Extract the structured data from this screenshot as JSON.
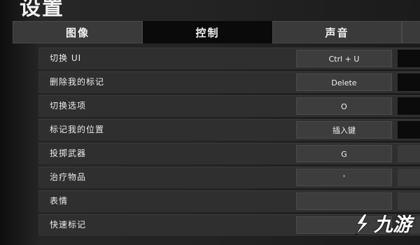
{
  "title": "设置",
  "tabs": [
    {
      "label": "图像",
      "active": false
    },
    {
      "label": "控制",
      "active": true
    },
    {
      "label": "声音",
      "active": false
    }
  ],
  "bindings": [
    {
      "label": "切换 UI",
      "key": "Ctrl + U"
    },
    {
      "label": "删除我的标记",
      "key": "Delete"
    },
    {
      "label": "切换选项",
      "key": "O"
    },
    {
      "label": "标记我的位置",
      "key": "插入键"
    },
    {
      "label": "投掷武器",
      "key": "G"
    },
    {
      "label": "治疗物品",
      "key": "'"
    },
    {
      "label": "表情",
      "key": ""
    },
    {
      "label": "快速标记",
      "key": ""
    }
  ],
  "watermark": {
    "text": "九游",
    "icon": "jiuyou-logo-icon"
  },
  "colors": {
    "active_tab": "#0a0a0a",
    "tab": "#3a3a3a",
    "row": "#2f2f2f"
  }
}
